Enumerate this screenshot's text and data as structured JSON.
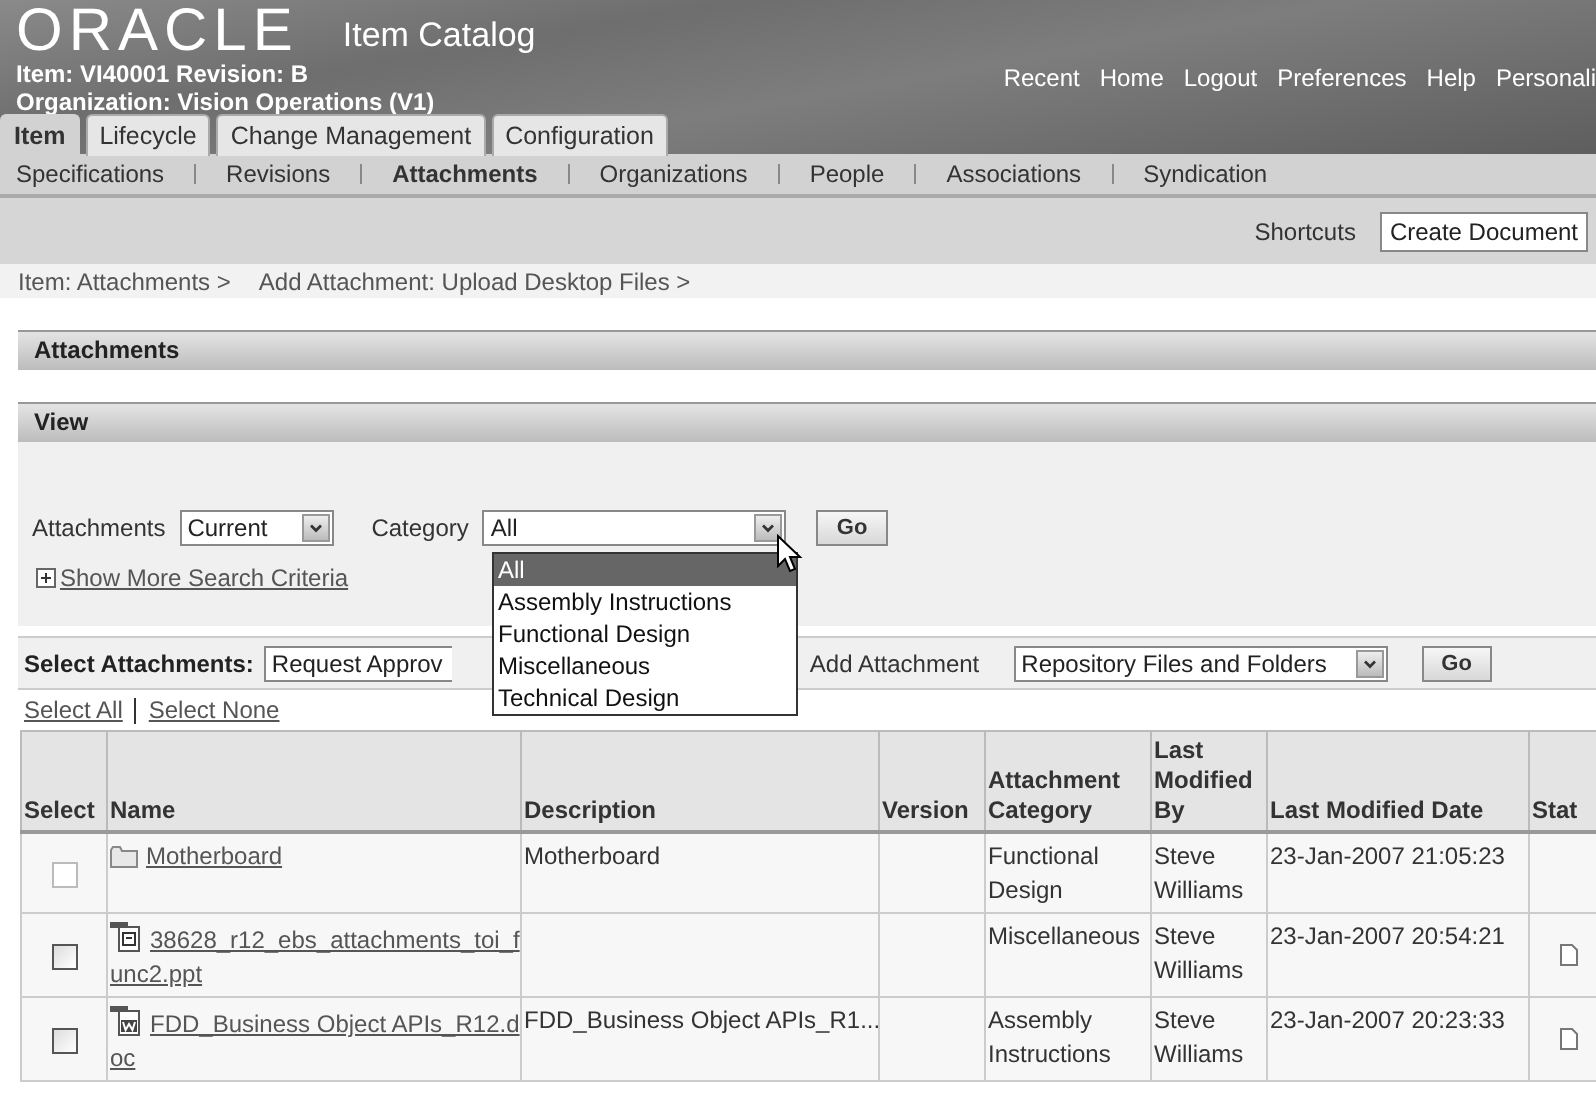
{
  "header": {
    "logo": "ORACLE",
    "app_title": "Item Catalog",
    "item_line": "Item: VI40001  Revision: B",
    "org_line": "Organization: Vision Operations (V1)",
    "global_links": [
      "Recent",
      "Home",
      "Logout",
      "Preferences",
      "Help",
      "Personali"
    ]
  },
  "tabs": [
    {
      "label": "Item",
      "selected": true
    },
    {
      "label": "Lifecycle",
      "selected": false
    },
    {
      "label": "Change Management",
      "selected": false
    },
    {
      "label": "Configuration",
      "selected": false
    }
  ],
  "subtabs": [
    {
      "label": "Specifications",
      "selected": false
    },
    {
      "label": "Revisions",
      "selected": false
    },
    {
      "label": "Attachments",
      "selected": true
    },
    {
      "label": "Organizations",
      "selected": false
    },
    {
      "label": "People",
      "selected": false
    },
    {
      "label": "Associations",
      "selected": false
    },
    {
      "label": "Syndication",
      "selected": false
    }
  ],
  "shortcuts": {
    "label": "Shortcuts",
    "value": "Create Document"
  },
  "breadcrumbs": [
    "Item: Attachments  >",
    "Add Attachment: Upload Desktop Files  >"
  ],
  "sections": [
    "Attachments",
    "View"
  ],
  "view": {
    "attachments_label": "Attachments",
    "attachments_value": "Current",
    "category_label": "Category",
    "category_value": "All",
    "go": "Go",
    "more_criteria": "Show More Search Criteria",
    "category_options": [
      {
        "label": "All",
        "selected": true
      },
      {
        "label": "Assembly Instructions",
        "selected": false
      },
      {
        "label": "Functional Design",
        "selected": false
      },
      {
        "label": "Miscellaneous",
        "selected": false
      },
      {
        "label": "Technical Design",
        "selected": false
      }
    ]
  },
  "actions": {
    "select_label": "Select Attachments:",
    "select_value": "Request Approv",
    "add_label": "Add Attachment",
    "add_value": "Repository Files and Folders",
    "go": "Go",
    "select_all": "Select All",
    "select_none": "Select None"
  },
  "table": {
    "columns": [
      "Select",
      "Name",
      "Description",
      "Version",
      "Attachment Category",
      "Last Modified By",
      "Last Modified Date",
      "Stat"
    ],
    "rows": [
      {
        "checked": false,
        "disabled": true,
        "kind": "folder",
        "name": "Motherboard",
        "description": "Motherboard",
        "version": "",
        "category": "Functional Design",
        "modified_by": "Steve Williams",
        "modified_date": "23-Jan-2007 21:05:23",
        "status_icon": false
      },
      {
        "checked": false,
        "disabled": false,
        "kind": "presentation",
        "name": "38628_r12_ebs_attachments_toi_func2.ppt",
        "description": "",
        "version": "",
        "category": "Miscellaneous",
        "modified_by": "Steve Williams",
        "modified_date": "23-Jan-2007 20:54:21",
        "status_icon": true
      },
      {
        "checked": false,
        "disabled": false,
        "kind": "document",
        "name": "FDD_Business Object APIs_R12.doc",
        "description": "FDD_Business Object APIs_R1...",
        "version": "",
        "category": "Assembly Instructions",
        "modified_by": "Steve Williams",
        "modified_date": "23-Jan-2007 20:23:33",
        "status_icon": true
      }
    ]
  }
}
